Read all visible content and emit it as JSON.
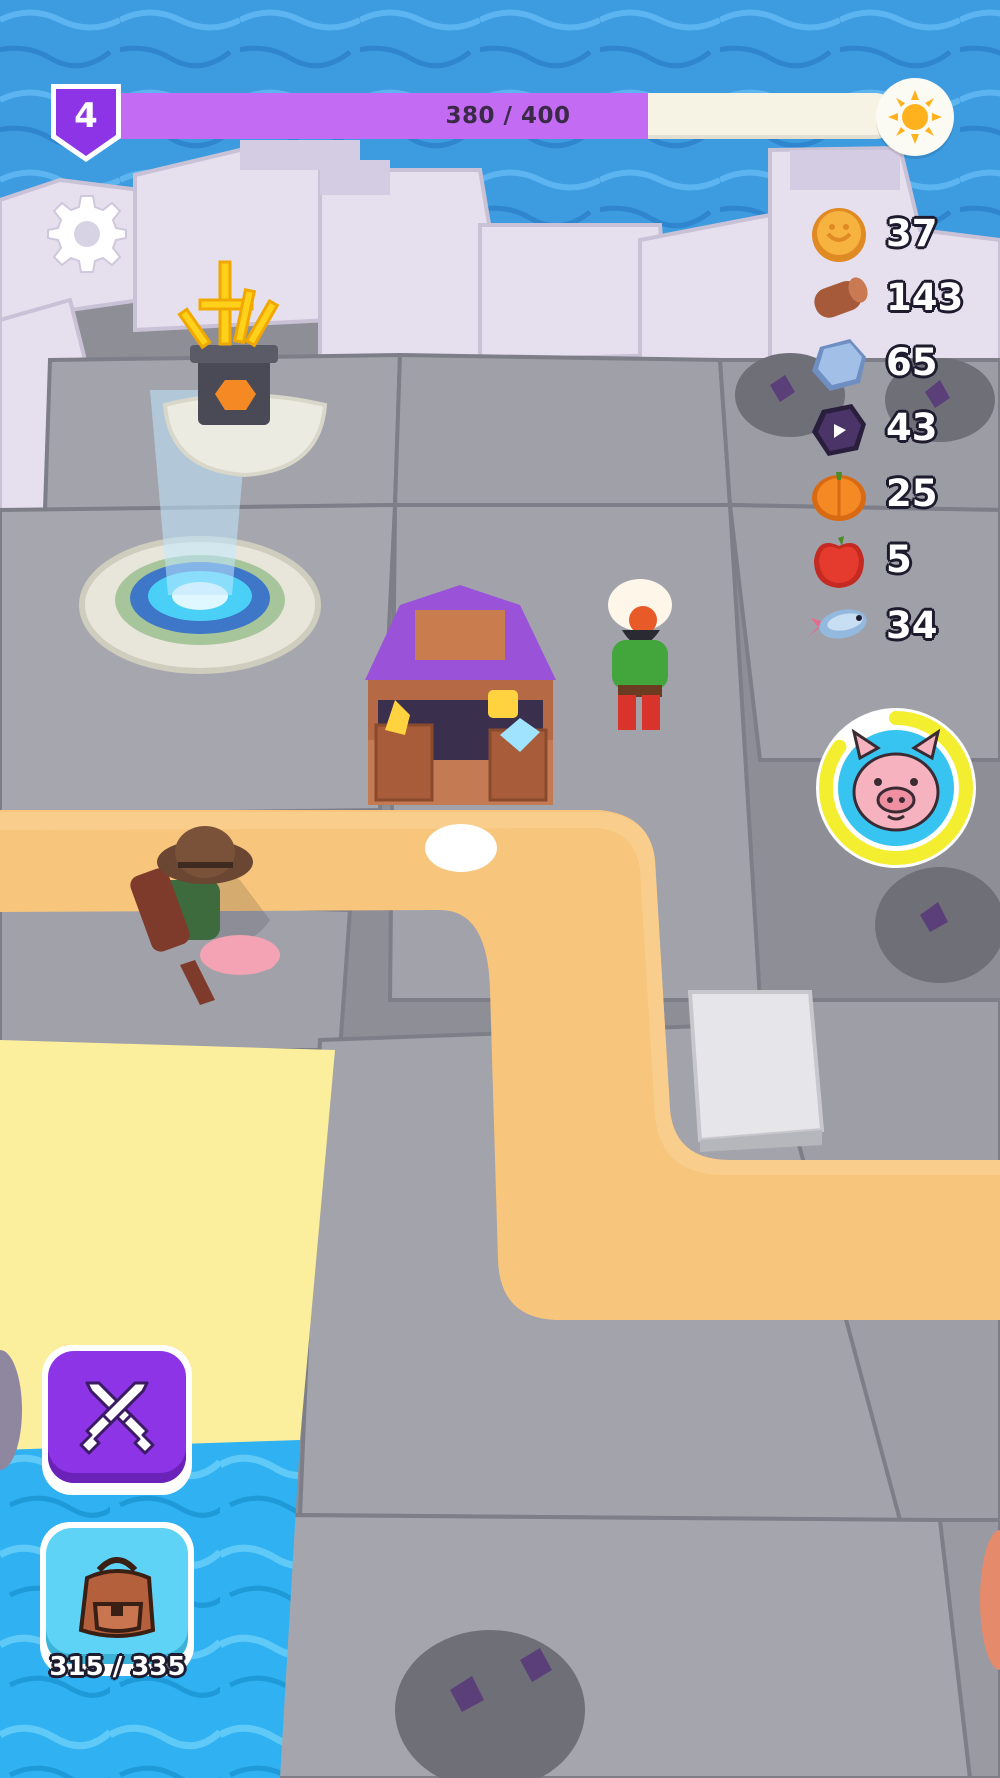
{
  "hud": {
    "level": "4",
    "xp_text": "380 / 400",
    "xp_progress": 0.95,
    "xp_fill_fraction": 0.68,
    "colors": {
      "xp_fill": "#c36bf2",
      "level_badge": "#8d35e6",
      "sun": "#ffb21e"
    }
  },
  "resources": [
    {
      "name": "coin",
      "icon": "coin-icon",
      "value": "37",
      "color": "#f2a83c"
    },
    {
      "name": "wood",
      "icon": "wood-log-icon",
      "value": "143",
      "color": "#a65a3a"
    },
    {
      "name": "stone",
      "icon": "stone-icon",
      "value": "65",
      "color": "#93b3e0"
    },
    {
      "name": "crystal",
      "icon": "dark-crystal-icon",
      "value": "43",
      "color": "#4b3568"
    },
    {
      "name": "pumpkin",
      "icon": "pumpkin-icon",
      "value": "25",
      "color": "#f58a24"
    },
    {
      "name": "apple",
      "icon": "apple-icon",
      "value": "5",
      "color": "#e53a2e"
    },
    {
      "name": "fish",
      "icon": "fish-icon",
      "value": "34",
      "color": "#93b9de"
    }
  ],
  "pet": {
    "icon": "pig-face-icon",
    "cooldown_fraction": 0.85
  },
  "actions": {
    "attack_icon": "crossed-swords-icon",
    "backpack_icon": "backpack-icon",
    "backpack_capacity": "315 / 335"
  }
}
